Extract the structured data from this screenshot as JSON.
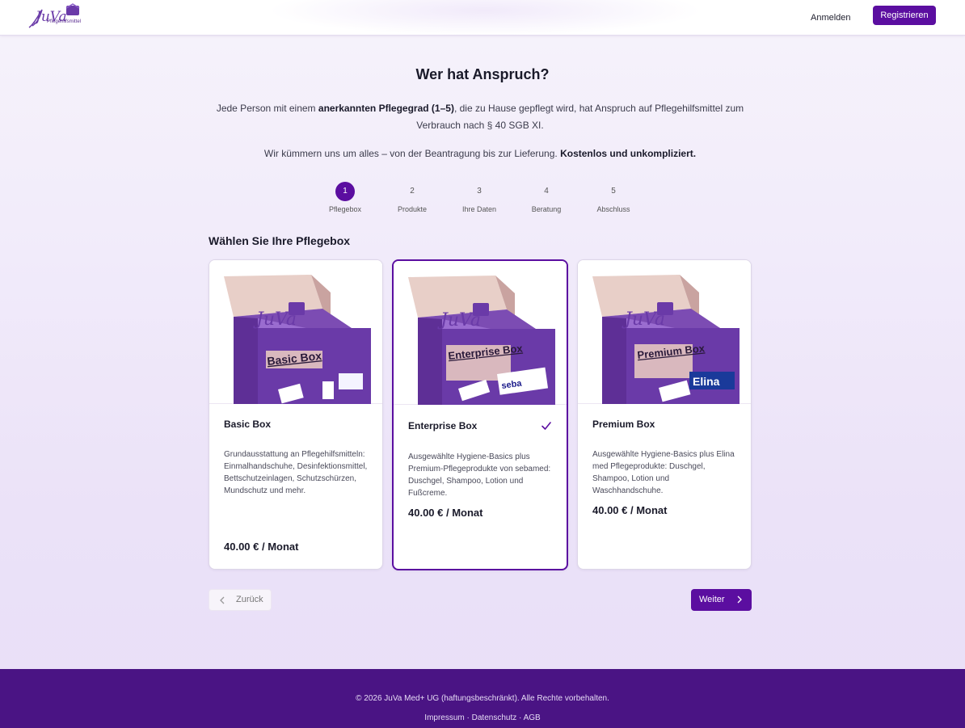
{
  "header": {
    "logo_text": "JuVa",
    "logo_subtitle": "Pflegehilfsmittel",
    "login_label": "Anmelden",
    "register_label": "Registrieren"
  },
  "main": {
    "title": "Wer hat Anspruch?",
    "intro_part1": "Jede Person mit einem ",
    "intro_bold": "anerkannten Pflegegrad (1–5)",
    "intro_part2": ", die zu Hause gepflegt wird, hat Anspruch auf Pflegehilfsmittel zum Verbrauch nach § 40 SGB XI.",
    "intro2_part1": "Wir kümmern uns um alles – von der Beantragung bis zur Lieferung. ",
    "intro2_bold": "Kostenlos und unkompliziert.",
    "section_title": "Wählen Sie Ihre Pflegebox"
  },
  "steps": [
    {
      "number": "1",
      "label": "Pflegebox",
      "active": true
    },
    {
      "number": "2",
      "label": "Produkte",
      "active": false
    },
    {
      "number": "3",
      "label": "Ihre Daten",
      "active": false
    },
    {
      "number": "4",
      "label": "Beratung",
      "active": false
    },
    {
      "number": "5",
      "label": "Abschluss",
      "active": false
    }
  ],
  "cards": [
    {
      "name": "Basic Box",
      "box_label": "Basic Box",
      "description": "Grundausstattung an Pflegehilfsmitteln: Einmalhandschuhe, Desinfektionsmittel, Bettschutzeinlagen, Schutzschürzen, Mundschutz und mehr.",
      "price": "40.00 € / Monat",
      "selected": false
    },
    {
      "name": "Enterprise Box",
      "box_label": "Enterprise Box",
      "description": "Ausgewählte Hygiene-Basics plus Premium-Pflegeprodukte von sebamed: Duschgel, Shampoo, Lotion und Fußcreme.",
      "price": "40.00 € / Monat",
      "selected": true
    },
    {
      "name": "Premium Box",
      "box_label": "Premium Box",
      "description": "Ausgewählte Hygiene-Basics plus Elina med Pflegeprodukte: Duschgel, Shampoo, Lotion und Waschhandschuhe.",
      "price": "40.00 € / Monat",
      "selected": false
    }
  ],
  "navigation": {
    "back_label": "Zurück",
    "next_label": "Weiter"
  },
  "footer": {
    "copyright": "© 2026 JuVa Med+ UG (haftungsbeschränkt). Alle Rechte vorbehalten.",
    "links": [
      "Impressum",
      "Datenschutz",
      "AGB"
    ],
    "separator": " · "
  },
  "colors": {
    "brand_purple": "#5b0ea0",
    "footer_purple": "#4a1484",
    "box_purple": "#6a3aa8"
  },
  "icons": {
    "selected_marker": "check-icon",
    "back": "chevron-left-icon",
    "next": "chevron-right-icon"
  }
}
